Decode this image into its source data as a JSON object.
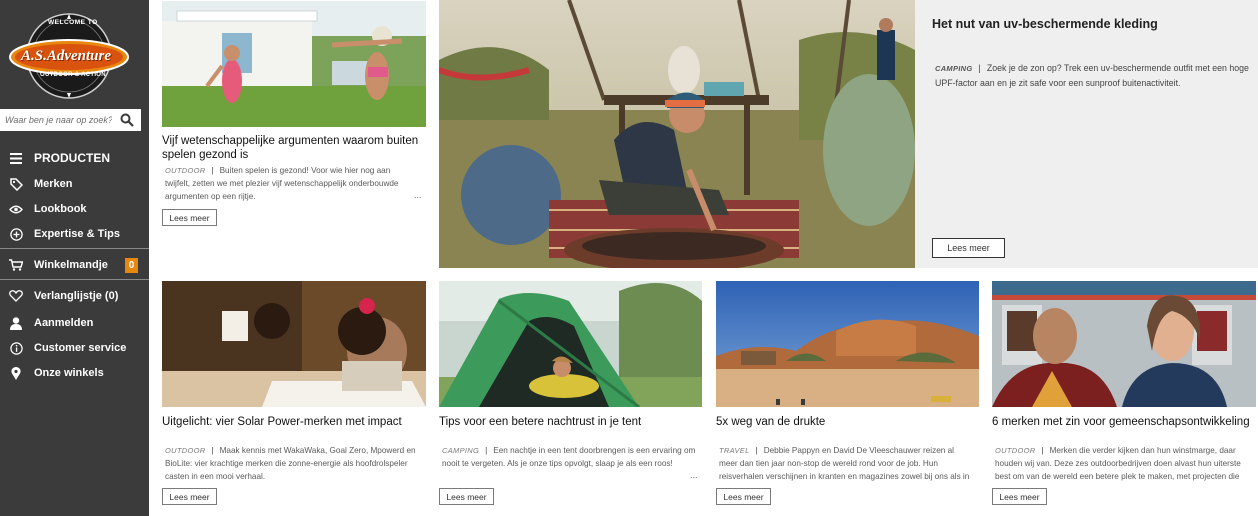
{
  "brand": {
    "top_text": "WELCOME TO",
    "name": "A.S.Adventure",
    "tagline": "OUTDOOR & ACTION"
  },
  "search": {
    "placeholder": "Waar ben je naar op zoek?"
  },
  "nav": {
    "products": "PRODUCTEN",
    "brands": "Merken",
    "lookbook": "Lookbook",
    "expertise": "Expertise & Tips",
    "cart": "Winkelmandje",
    "cart_count": "0",
    "wishlist": "Verlanglijstje (0)",
    "login": "Aanmelden",
    "service": "Customer service",
    "stores": "Onze winkels"
  },
  "featured": {
    "title": "Het nut van uv-beschermende kleding",
    "category": "CAMPING",
    "text": "Zoek je de zon op? Trek een uv-beschermende outfit met een hoge UPF-factor aan en je zit safe voor een sunproof buitenactiviteit.",
    "button": "Lees meer"
  },
  "articles": [
    {
      "title": "Vijf wetenschappelijke argumenten waarom buiten spelen gezond is",
      "category": "OUTDOOR",
      "text": "Buiten spelen is gezond! Voor wie hier nog aan twijfelt, zetten we met plezier vijf wetenschappelijk onderbouwde argumenten op een rijtje.",
      "button": "Lees meer"
    },
    {
      "title": "Uitgelicht: vier Solar Power-merken met impact",
      "category": "OUTDOOR",
      "text": "Maak kennis met WakaWaka, Goal Zero, Mpowerd en BioLite: vier krachtige merken die zonne-energie als hoofdrolspeler casten in een mooi verhaal.",
      "button": "Lees meer"
    },
    {
      "title": "Tips voor een betere nachtrust in je tent",
      "category": "CAMPING",
      "text": "Een nachtje in een tent doorbrengen is een ervaring om nooit te vergeten. Als je onze tips opvolgt, slaap je als een roos!",
      "button": "Lees meer"
    },
    {
      "title": "5x weg van de drukte",
      "category": "TRAVEL",
      "text": "Debbie Pappyn en David De Vleeschauwer reizen al meer dan tien jaar non-stop de wereld rond voor de job. Hun reisverhalen verschijnen in kranten en magazines zowel bij ons als in het buitenland.",
      "button": "Lees meer"
    },
    {
      "title": "6 merken met zin voor gemeenschapsontwikkeling",
      "category": "OUTDOOR",
      "text": "Merken die verder kijken dan hun winstmarge, daar houden wij van. Deze zes outdoorbedrijven doen alvast hun uiterste best om van de wereld een betere plek te maken, met projecten die het verschil maken.",
      "button": "Lees meer"
    }
  ],
  "ellipsis": "...",
  "colors": {
    "sidebar": "#3b3b3b",
    "accent": "#e8870e",
    "panel": "#efefef"
  }
}
